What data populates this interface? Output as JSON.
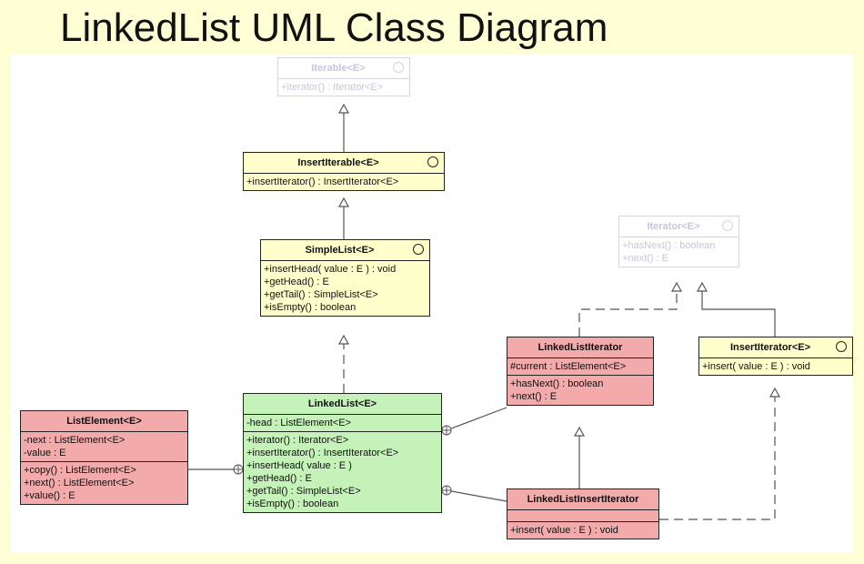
{
  "title": "LinkedList UML Class Diagram",
  "classes": {
    "iterable": {
      "name": "Iterable<E>",
      "methods": [
        "+iterator() : Iterator<E>"
      ]
    },
    "insertIterable": {
      "name": "InsertIterable<E>",
      "methods": [
        "+insertIterator() : InsertIterator<E>"
      ]
    },
    "simpleList": {
      "name": "SimpleList<E>",
      "methods": [
        "+insertHead( value : E ) : void",
        "+getHead() : E",
        "+getTail() : SimpleList<E>",
        "+isEmpty() : boolean"
      ]
    },
    "iterator": {
      "name": "Iterator<E>",
      "methods": [
        "+hasNext() : boolean",
        "+next() : E"
      ]
    },
    "linkedListIterator": {
      "name": "LinkedListIterator",
      "fields": [
        "#current : ListElement<E>"
      ],
      "methods": [
        "+hasNext() : boolean",
        "+next() : E"
      ]
    },
    "insertIterator": {
      "name": "InsertIterator<E>",
      "methods": [
        "+insert( value : E ) : void"
      ]
    },
    "listElement": {
      "name": "ListElement<E>",
      "fields": [
        "-next : ListElement<E>",
        "-value : E"
      ],
      "methods": [
        "+copy() : ListElement<E>",
        "+next() : ListElement<E>",
        "+value() : E"
      ]
    },
    "linkedList": {
      "name": "LinkedList<E>",
      "fields": [
        "-head : ListElement<E>"
      ],
      "methods": [
        "+iterator() : Iterator<E>",
        "+insertIterator() : InsertIterator<E>",
        "+insertHead( value : E )",
        "+getHead() : E",
        "+getTail() : SimpleList<E>",
        "+isEmpty() : boolean"
      ]
    },
    "linkedListInsertIterator": {
      "name": "LinkedListInsertIterator",
      "fields": [],
      "methods": [
        "+insert( value : E ) : void"
      ]
    }
  },
  "colors": {
    "background": "#ffffd5",
    "interface": "#ffffcc",
    "concrete": "#f2aaaa",
    "focus": "#c4f2b8",
    "ghost": "#d4d4e6"
  }
}
